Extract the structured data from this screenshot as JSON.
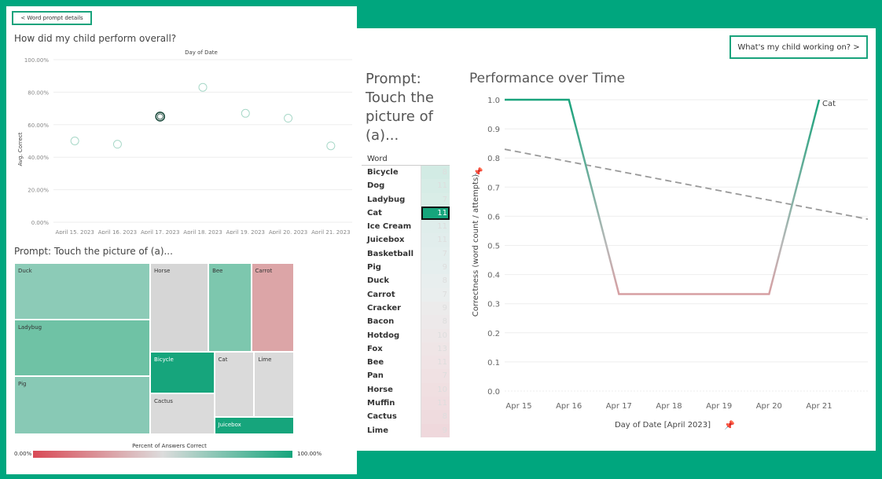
{
  "left": {
    "back_button": "< Word prompt details",
    "overall_title": "How did my child perform overall?",
    "scatter": {
      "x_title": "Day of Date",
      "y_title": "Avg. Correct",
      "y_ticks": [
        "0.00%",
        "20.00%",
        "40.00%",
        "60.00%",
        "80.00%",
        "100.00%"
      ],
      "x_ticks": [
        "April 15, 2023",
        "April 16, 2023",
        "April 17, 2023",
        "April 18, 2023",
        "April 19, 2023",
        "April 20, 2023",
        "April 21, 2023"
      ]
    },
    "treemap_title": "Prompt: Touch the picture of (a)...",
    "treemap": [
      {
        "label": "Duck",
        "pct": 0.6,
        "color": "#8ccbb7"
      },
      {
        "label": "Ladybug",
        "pct": 0.75,
        "color": "#6fc2a5"
      },
      {
        "label": "Pig",
        "pct": 0.65,
        "color": "#88c9b5"
      },
      {
        "label": "Horse",
        "pct": 0.4,
        "color": "#d6d6d6"
      },
      {
        "label": "Bee",
        "pct": 0.7,
        "color": "#7dc7ae"
      },
      {
        "label": "Carrot",
        "pct": 0.25,
        "color": "#dca5a7"
      },
      {
        "label": "Bicycle",
        "pct": 1.0,
        "color": "#16a57c"
      },
      {
        "label": "Cactus",
        "pct": 0.45,
        "color": "#dadada"
      },
      {
        "label": "Cat",
        "pct": 0.45,
        "color": "#dadada"
      },
      {
        "label": "Lime",
        "pct": 0.45,
        "color": "#dadada"
      },
      {
        "label": "Juicebox",
        "pct": 1.0,
        "color": "#16a57c"
      }
    ],
    "legend": {
      "title": "Percent of Answers Correct",
      "min": "0.00%",
      "max": "100.00%"
    }
  },
  "right": {
    "forward_button": "What's my child working on? >",
    "prompt_title": "Prompt: Touch the picture of (a)...",
    "table_header": "Word",
    "words": [
      {
        "name": "Bicycle",
        "value": "8"
      },
      {
        "name": "Dog",
        "value": "11"
      },
      {
        "name": "Ladybug",
        "value": "7"
      },
      {
        "name": "Cat",
        "value": "11"
      },
      {
        "name": "Ice Cream",
        "value": "11"
      },
      {
        "name": "Juicebox",
        "value": "11"
      },
      {
        "name": "Basketball",
        "value": "7"
      },
      {
        "name": "Pig",
        "value": "9"
      },
      {
        "name": "Duck",
        "value": "8"
      },
      {
        "name": "Carrot",
        "value": "7"
      },
      {
        "name": "Cracker",
        "value": "9"
      },
      {
        "name": "Bacon",
        "value": "8"
      },
      {
        "name": "Hotdog",
        "value": "10"
      },
      {
        "name": "Fox",
        "value": "13"
      },
      {
        "name": "Bee",
        "value": "11"
      },
      {
        "name": "Pan",
        "value": "7"
      },
      {
        "name": "Horse",
        "value": "10"
      },
      {
        "name": "Muffin",
        "value": "11"
      },
      {
        "name": "Cactus",
        "value": "8"
      },
      {
        "name": "Lime",
        "value": "9"
      }
    ],
    "selected_word": "Cat",
    "perf_title": "Performance over Time",
    "series_label": "Cat"
  },
  "chart_data": [
    {
      "type": "scatter",
      "title": "How did my child perform overall?",
      "xlabel": "Day of Date",
      "ylabel": "Avg. Correct",
      "x": [
        "April 15, 2023",
        "April 16, 2023",
        "April 17, 2023",
        "April 18, 2023",
        "April 19, 2023",
        "April 20, 2023",
        "April 21, 2023"
      ],
      "values": [
        0.5,
        0.48,
        0.65,
        0.83,
        0.67,
        0.64,
        0.47
      ],
      "ylim": [
        0,
        1
      ],
      "highlight_index": 2
    },
    {
      "type": "line",
      "title": "Performance over Time",
      "xlabel": "Day of Date [April 2023]",
      "ylabel": "Correctness (word count / attempts)",
      "x": [
        "Apr 15",
        "Apr 16",
        "Apr 17",
        "Apr 18",
        "Apr 19",
        "Apr 20",
        "Apr 21"
      ],
      "series": [
        {
          "name": "Cat",
          "values": [
            1.0,
            1.0,
            0.333,
            0.333,
            0.333,
            0.333,
            1.0
          ]
        }
      ],
      "trend": {
        "start": 0.83,
        "end": 0.59
      },
      "ylim": [
        0,
        1
      ],
      "y_ticks": [
        "0.0",
        "0.1",
        "0.2",
        "0.3",
        "0.4",
        "0.5",
        "0.6",
        "0.7",
        "0.8",
        "0.9",
        "1.0"
      ]
    }
  ]
}
